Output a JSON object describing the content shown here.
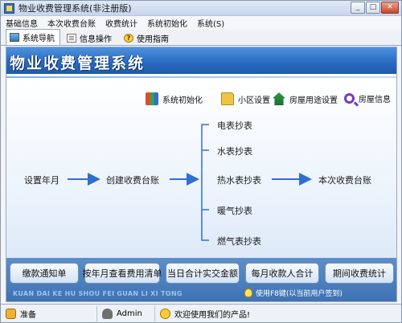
{
  "window": {
    "title": "物业收费管理系统(非注册版)",
    "controls": {
      "minimize": "_",
      "maximize": "□",
      "close": "✕"
    }
  },
  "menu": [
    "基础信息",
    "本次收费台账",
    "收费统计",
    "系统初始化",
    "系统(S)"
  ],
  "tabs": [
    {
      "label": "系统导航",
      "icon": "monitor-icon"
    },
    {
      "label": "信息操作",
      "icon": "document-icon"
    },
    {
      "label": "使用指南",
      "icon": "help-icon"
    }
  ],
  "banner": {
    "title": "物业收费管理系统"
  },
  "quick_links": [
    {
      "label": "系统初始化",
      "icon": "books-icon"
    },
    {
      "label": "小区设置",
      "icon": "folder-icon"
    },
    {
      "label": "房屋用途设置",
      "icon": "house-icon"
    },
    {
      "label": "房屋信息",
      "icon": "search-icon"
    }
  ],
  "flow": {
    "start": "设置年月",
    "create": "创建收费台账",
    "meters": [
      "电表抄表",
      "水表抄表",
      "热水表抄表",
      "暖气抄表",
      "燃气表抄表"
    ],
    "result": "本次收费台账"
  },
  "actions": [
    "缴款通知单",
    "按年月查看费用清单",
    "当日合计实交金额",
    "每月收款人合计",
    "期间收费统计"
  ],
  "footer": {
    "pinyin": "KUAN DAI KE HU SHOU FEI GUAN LI XI TONG",
    "tip": "使用F8键(以当前用户签到)"
  },
  "status": {
    "ready": "准备",
    "user": "Admin",
    "welcome": "欢迎使用我们的产品!"
  },
  "colors": {
    "banner": "#2a6cc2",
    "arrow": "#2f6fd0",
    "bottom_bar": "#3e71b3"
  }
}
